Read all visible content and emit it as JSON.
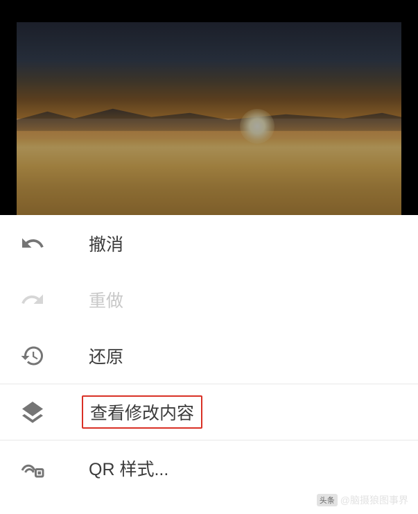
{
  "menu": {
    "undo": {
      "label": "撤消",
      "icon": "undo-icon"
    },
    "redo": {
      "label": "重做",
      "icon": "redo-icon"
    },
    "revert": {
      "label": "还原",
      "icon": "history-icon"
    },
    "view_edits": {
      "label": "查看修改内容",
      "icon": "layers-icon"
    },
    "qr_style": {
      "label": "QR 样式...",
      "icon": "qr-style-icon"
    }
  },
  "watermark": {
    "prefix": "头条",
    "handle": "@脑摄狼图事界"
  }
}
